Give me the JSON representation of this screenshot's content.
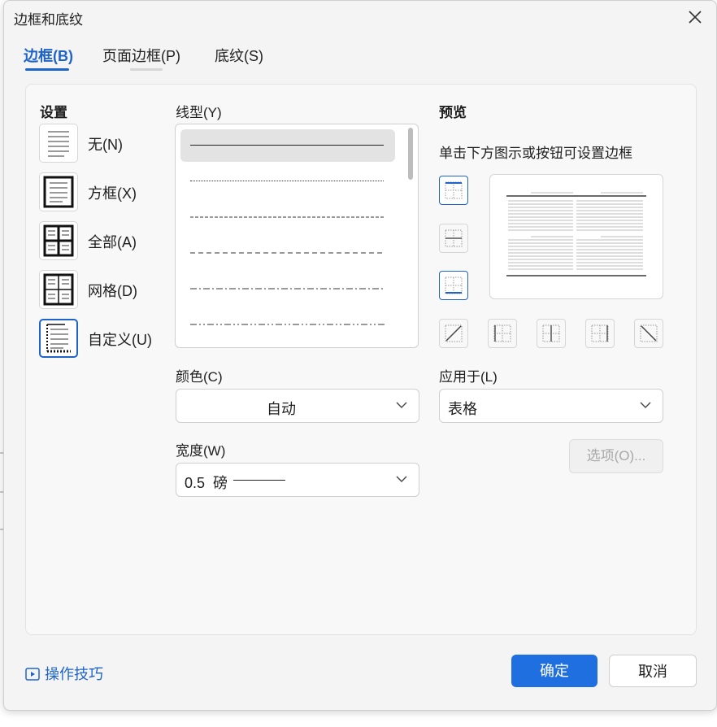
{
  "window": {
    "title": "边框和底纹"
  },
  "tabs": [
    {
      "label": "边框(B)"
    },
    {
      "label": "页面边框(P)"
    },
    {
      "label": "底纹(S)"
    }
  ],
  "settings": {
    "heading": "设置",
    "items": [
      {
        "label": "无(N)",
        "icon": "border-none-icon"
      },
      {
        "label": "方框(X)",
        "icon": "border-box-icon"
      },
      {
        "label": "全部(A)",
        "icon": "border-all-icon"
      },
      {
        "label": "网格(D)",
        "icon": "border-grid-icon"
      },
      {
        "label": "自定义(U)",
        "icon": "border-custom-icon"
      }
    ],
    "selected": "自定义(U)"
  },
  "line_style": {
    "label": "线型(Y)",
    "options": [
      "solid",
      "dotted",
      "dashed-fine",
      "dashed",
      "dash-dot",
      "dash-dot-dot"
    ],
    "selected": "solid"
  },
  "color": {
    "label": "颜色(C)",
    "value": "自动"
  },
  "width": {
    "label": "宽度(W)",
    "value": "0.5  磅"
  },
  "preview": {
    "heading": "预览",
    "hint": "单击下方图示或按钮可设置边框"
  },
  "apply_to": {
    "label": "应用于(L)",
    "value": "表格"
  },
  "options_button": {
    "label": "选项(O)..."
  },
  "tips_link": {
    "label": "操作技巧"
  },
  "buttons": {
    "ok": "确定",
    "cancel": "取消"
  },
  "colors": {
    "accent": "#1e64c8",
    "primary_button": "#1f6fe0",
    "dialog_bg": "#f4f4f4"
  }
}
